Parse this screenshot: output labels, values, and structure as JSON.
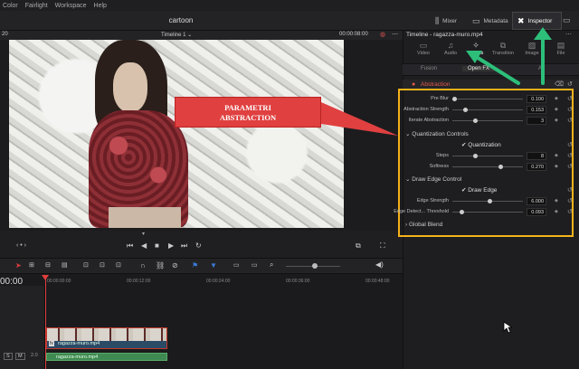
{
  "menu": [
    "Color",
    "Fairlight",
    "Workspace",
    "Help"
  ],
  "app_title": "cartoon",
  "top_buttons": {
    "mixer": "Mixer",
    "metadata": "Metadata",
    "inspector": "Inspector"
  },
  "viewer": {
    "left_num": "20",
    "timeline_label": "Timeline 1",
    "timecode": "00:00:08:00"
  },
  "callout": {
    "line1": "PARAMETRI",
    "line2": "ABSTRACTION"
  },
  "timeline": {
    "timecode": "00:00",
    "ruler": [
      "00:00:00:00",
      "00:00:12:00",
      "00:00:24:00",
      "00:00:36:00",
      "00:00:48:00"
    ],
    "video_clip": "ragazza-muro.mp4",
    "audio_clip": "ragazza-muro.mp4",
    "track_v_label": "V1",
    "track_a_label": "S",
    "track_m_label": "M",
    "track_a_num": "2.0"
  },
  "inspector": {
    "title": "Timeline - ragazza-muro.mp4",
    "tabs": [
      "Video",
      "Audio",
      "Effects",
      "Transition",
      "Image",
      "File"
    ],
    "sub_tabs": [
      "Fusion",
      "Open FX",
      "Au"
    ],
    "section": "Abstraction",
    "params": [
      {
        "label": "Pre Blur",
        "value": "0.100",
        "pos": 0.05
      },
      {
        "label": "Abstraction Strength",
        "value": "0.153",
        "pos": 0.15
      },
      {
        "label": "Iterate Abstraction",
        "value": "3",
        "pos": 0.3
      }
    ],
    "quant_header": "Quantization Controls",
    "quant_check": "Quantization",
    "quant_params": [
      {
        "label": "Steps",
        "value": "8",
        "pos": 0.3
      },
      {
        "label": "Softness",
        "value": "0.270",
        "pos": 0.65
      }
    ],
    "edge_header": "Draw Edge Control",
    "edge_check": "Draw Edge",
    "edge_params": [
      {
        "label": "Edge Strength",
        "value": "6.000",
        "pos": 0.5
      },
      {
        "label": "Edge Detect... Threshold",
        "value": "0.093",
        "pos": 0.1
      }
    ],
    "global_blend": "Global Blend"
  }
}
